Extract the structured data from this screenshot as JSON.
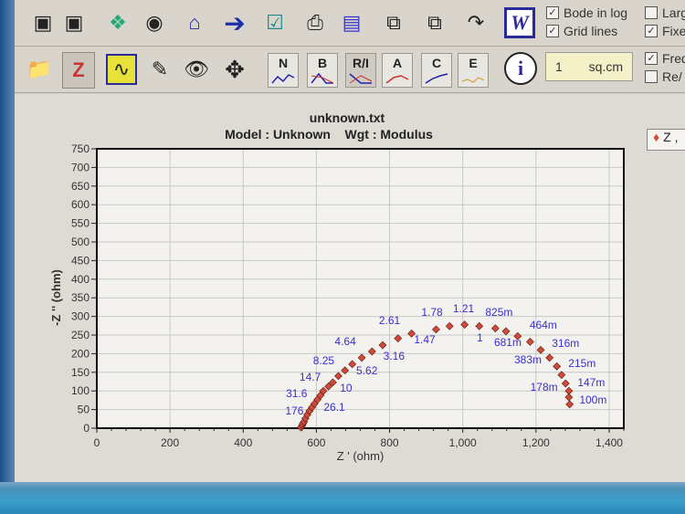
{
  "toolbar1": {
    "icons": [
      "connect-icon",
      "disconnect-icon",
      "data-file-icon",
      "find-icon",
      "home-icon",
      "forward-arrow-icon",
      "check-icon",
      "print-icon",
      "report-icon",
      "copy-text-icon",
      "copy-graph-icon",
      "export-graph-icon",
      "word-icon"
    ],
    "word_label": "W",
    "checkboxes": [
      {
        "label": "Bode in log",
        "checked": true
      },
      {
        "label": "Grid lines",
        "checked": true
      },
      {
        "label": "Larg",
        "checked": false
      },
      {
        "label": "Fixe",
        "checked": true
      }
    ]
  },
  "toolbar2": {
    "icons": [
      "open-folder-icon",
      "sleep-icon",
      "waveform-icon",
      "notepad-icon",
      "eye-icon",
      "move-arrows-icon"
    ],
    "graph_buttons": [
      "N",
      "B",
      "R/I",
      "A",
      "C",
      "E"
    ],
    "info_label": "i",
    "area_value": "1",
    "area_unit": "sq.cm",
    "checkboxes": [
      {
        "label": "Freq",
        "checked": true
      },
      {
        "label": "Re/",
        "checked": false
      }
    ]
  },
  "chart_data": {
    "type": "scatter",
    "title": "unknown.txt",
    "subtitle_model": "Model : Unknown",
    "subtitle_weight": "Wgt : Modulus",
    "xlabel": "Z ' (ohm)",
    "ylabel": "-Z '' (ohm)",
    "xlim": [
      0,
      1440
    ],
    "ylim": [
      0,
      750
    ],
    "xticks": [
      0,
      200,
      400,
      600,
      800,
      1000,
      1200,
      1400
    ],
    "xtick_labels": [
      "0",
      "200",
      "400",
      "600",
      "800",
      "1,000",
      "1,200",
      "1,400"
    ],
    "yticks": [
      0,
      50,
      100,
      150,
      200,
      250,
      300,
      350,
      400,
      450,
      500,
      550,
      600,
      650,
      700,
      750
    ],
    "grid": true,
    "legend": {
      "position": "top-right",
      "entries": [
        "Z ,"
      ]
    },
    "series": [
      {
        "name": "Z ,",
        "color": "#d04a3a",
        "x": [
          558,
          561,
          563,
          566,
          570,
          575,
          581,
          588,
          595,
          603,
          611,
          619,
          633,
          645,
          660,
          678,
          698,
          724,
          752,
          781,
          823,
          860,
          927,
          964,
          1005,
          1045,
          1089,
          1118,
          1150,
          1184,
          1213,
          1237,
          1257,
          1270,
          1281,
          1290,
          1290,
          1292
        ],
        "y": [
          2,
          7,
          12,
          17,
          26,
          36,
          46,
          56,
          66,
          77,
          88,
          100,
          112,
          123,
          140,
          155,
          172,
          189,
          206,
          223,
          241,
          254,
          265,
          274,
          278,
          274,
          268,
          260,
          247,
          232,
          210,
          189,
          166,
          143,
          120,
          100,
          83,
          64
        ]
      }
    ],
    "frequency_labels": [
      {
        "text": "176",
        "x": 540,
        "y": 37
      },
      {
        "text": "31.6",
        "x": 546,
        "y": 83
      },
      {
        "text": "14.7",
        "x": 583,
        "y": 127
      },
      {
        "text": "8.25",
        "x": 620,
        "y": 172
      },
      {
        "text": "4.64",
        "x": 679,
        "y": 223
      },
      {
        "text": "2.61",
        "x": 800,
        "y": 279
      },
      {
        "text": "1.78",
        "x": 916,
        "y": 301
      },
      {
        "text": "1.21",
        "x": 1002,
        "y": 311
      },
      {
        "text": "825m",
        "x": 1099,
        "y": 301
      },
      {
        "text": "464m",
        "x": 1220,
        "y": 267
      },
      {
        "text": "316m",
        "x": 1281,
        "y": 218
      },
      {
        "text": "215m",
        "x": 1326,
        "y": 164
      },
      {
        "text": "147m",
        "x": 1351,
        "y": 113
      },
      {
        "text": "100m",
        "x": 1356,
        "y": 66
      },
      {
        "text": "26.1",
        "x": 649,
        "y": 47
      },
      {
        "text": "10",
        "x": 681,
        "y": 98
      },
      {
        "text": "5.62",
        "x": 738,
        "y": 145
      },
      {
        "text": "3.16",
        "x": 812,
        "y": 184
      },
      {
        "text": "1.47",
        "x": 896,
        "y": 228
      },
      {
        "text": "1",
        "x": 1047,
        "y": 233
      },
      {
        "text": "681m",
        "x": 1123,
        "y": 221
      },
      {
        "text": "383m",
        "x": 1178,
        "y": 174
      },
      {
        "text": "178m",
        "x": 1222,
        "y": 100
      }
    ],
    "label_color": "#3a2fd0"
  }
}
